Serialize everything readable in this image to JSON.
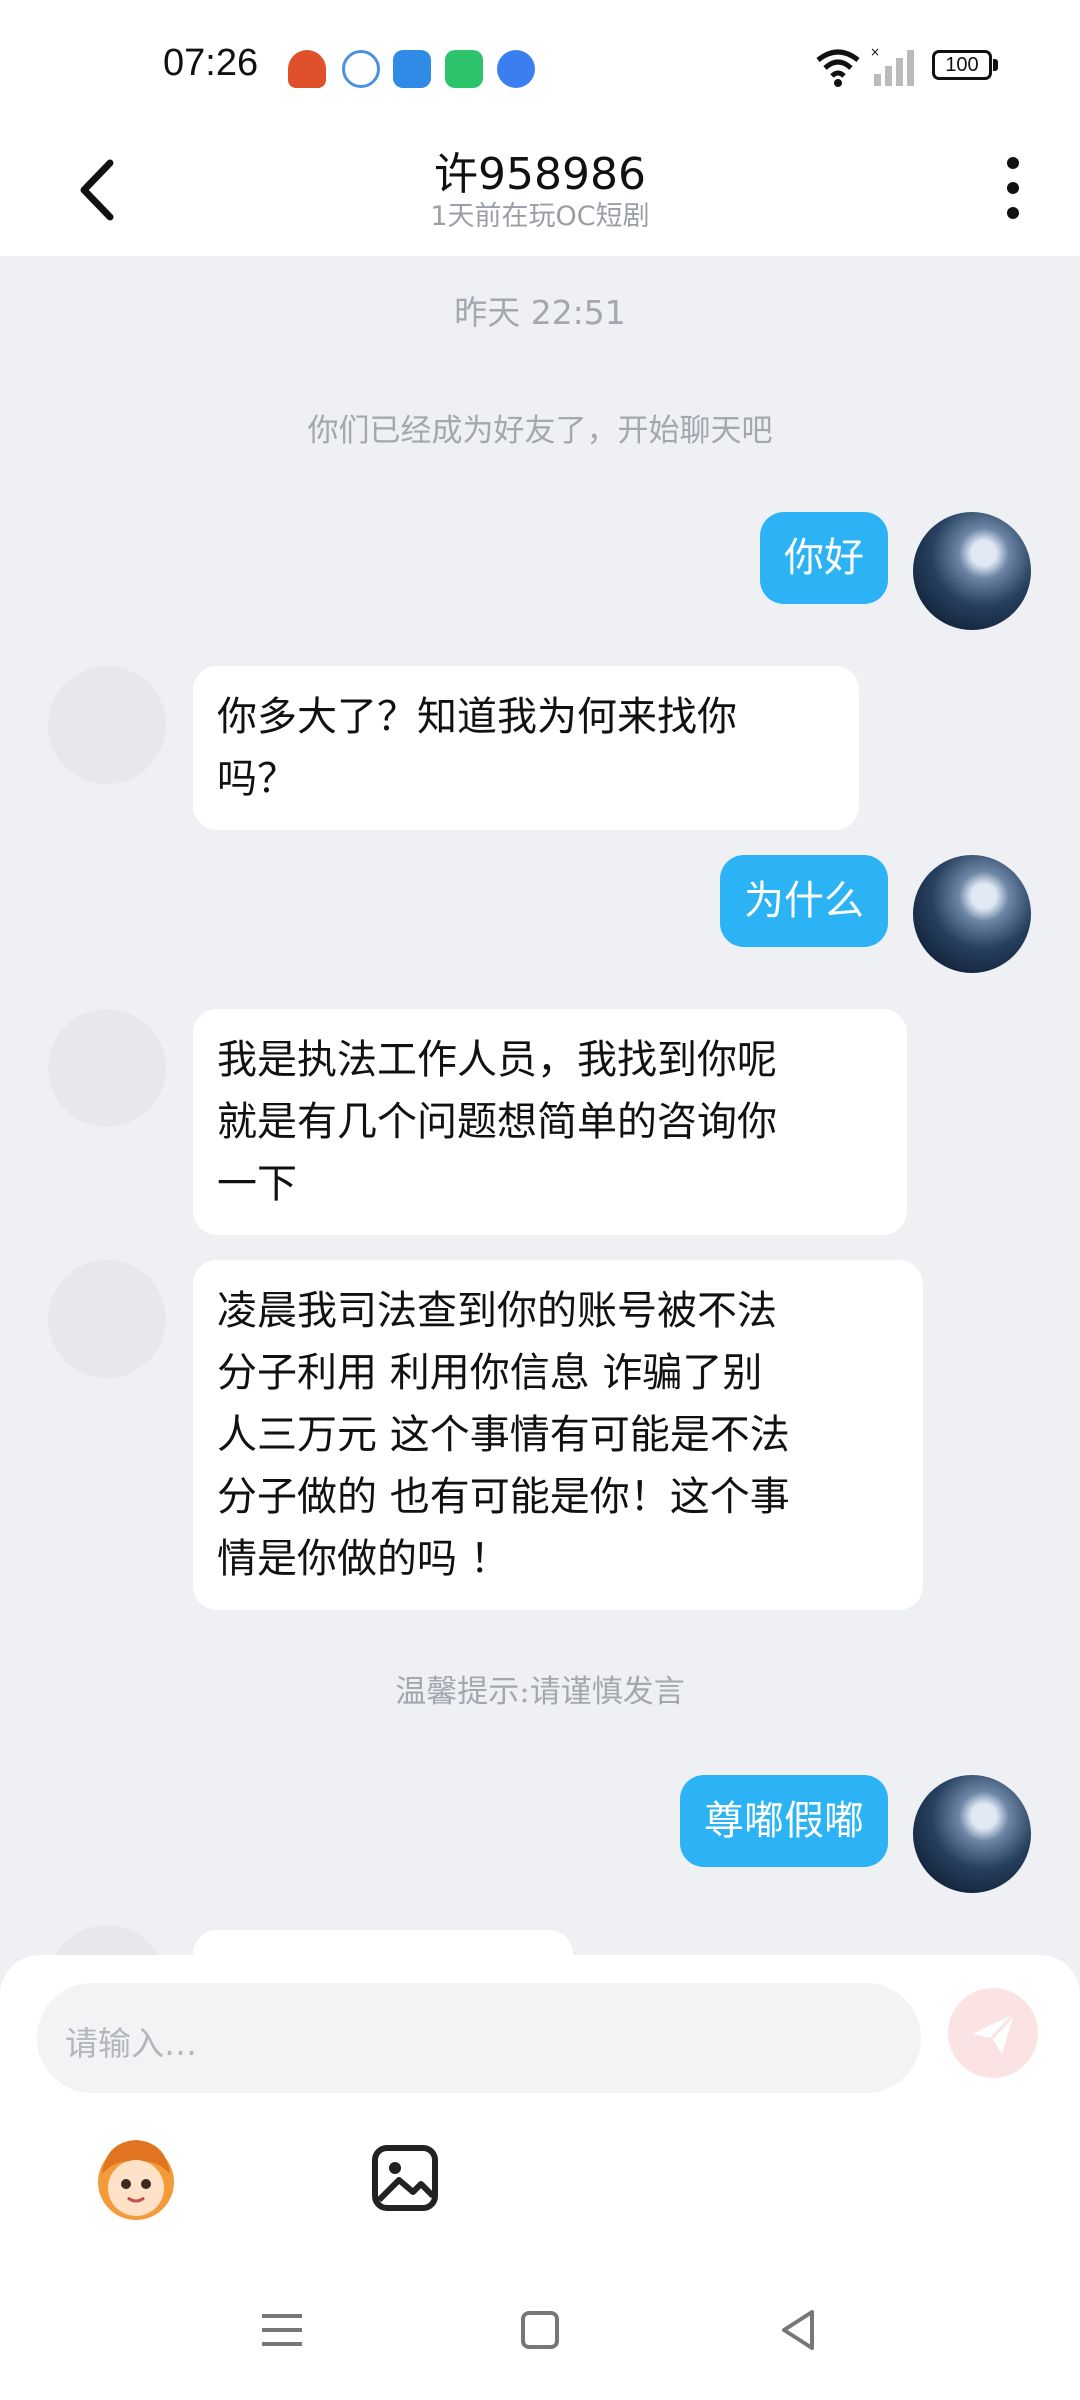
{
  "status_bar": {
    "time": "07:26",
    "battery": "100",
    "icons": [
      "app-notification-icon",
      "ifly-icon",
      "weather-icon",
      "green-app-icon",
      "blue-app-icon",
      "wifi-icon",
      "signal-icon",
      "battery-icon"
    ]
  },
  "header": {
    "title": "许958986",
    "subtitle": "1天前在玩OC短剧"
  },
  "chat": {
    "timestamp": "昨天 22:51",
    "system_friend": "你们已经成为好友了，开始聊天吧",
    "messages": [
      {
        "side": "me",
        "text": "你好"
      },
      {
        "side": "other",
        "lines": [
          "你多大了？知道我为何来找你",
          "吗？"
        ]
      },
      {
        "side": "me",
        "text": "为什么"
      },
      {
        "side": "other",
        "lines": [
          "我是执法工作人员，我找到你呢",
          "就是有几个问题想简单的咨询你",
          "一下"
        ]
      },
      {
        "side": "other",
        "lines": [
          "凌晨我司法查到你的账号被不法",
          "分子利用 利用你信息 诈骗了别",
          "人三万元 这个事情有可能是不法",
          "分子做的 也有可能是你！这个事",
          "情是你做的吗 ！"
        ]
      },
      {
        "side": "me",
        "text": "尊嘟假嘟"
      }
    ],
    "warning": "温馨提示:请谨慎发言"
  },
  "composer": {
    "placeholder": "请输入…"
  },
  "colors": {
    "accent_bubble": "#2bb3f5",
    "background": "#eef0f4",
    "send_button": "#fbe3e3"
  }
}
